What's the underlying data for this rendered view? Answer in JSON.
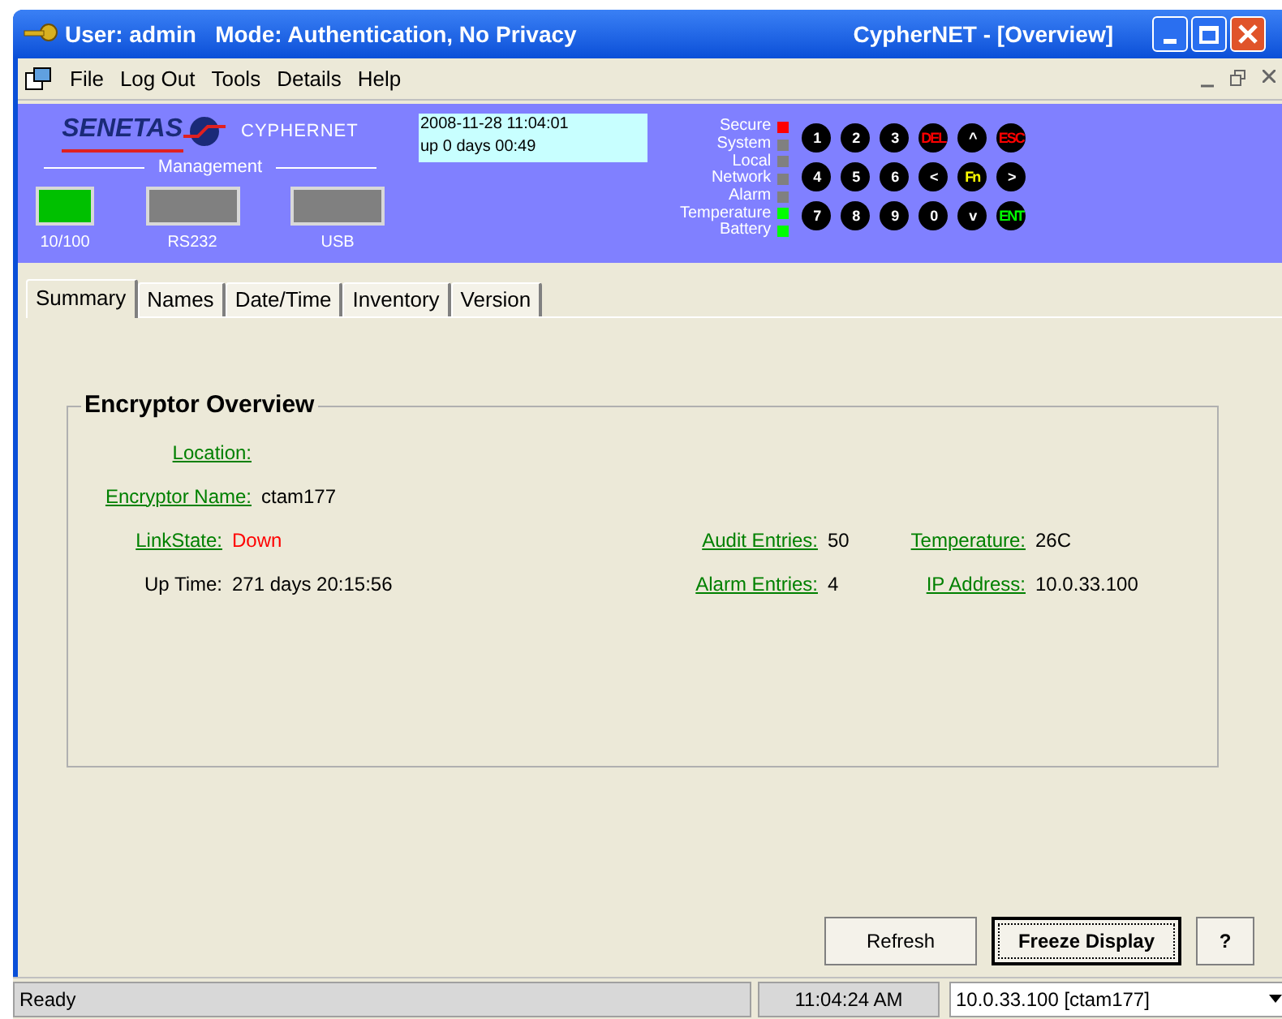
{
  "window": {
    "title_left": "User: admin   Mode: Authentication, No Privacy",
    "title_right": "CypherNET - [Overview]"
  },
  "menu": [
    "File",
    "Log Out",
    "Tools",
    "Details",
    "Help"
  ],
  "device": {
    "brand": "SENETAS",
    "product": "CYPHERNET",
    "clock": "2008-11-28 11:04:01",
    "uptime": "up 0 days 00:49",
    "management_label": "Management",
    "ports": [
      {
        "label": "10/100",
        "on": true
      },
      {
        "label": "RS232",
        "on": false
      },
      {
        "label": "USB",
        "on": false
      }
    ],
    "leds": [
      {
        "label": "Secure",
        "color": "#ff0000"
      },
      {
        "label": "System",
        "color": "#808080"
      },
      {
        "label": "Local",
        "color": "#808080"
      },
      {
        "label": "Network",
        "color": "#808080"
      },
      {
        "label": "Alarm",
        "color": "#808080"
      },
      {
        "label": "Temperature",
        "color": "#00ff00"
      },
      {
        "label": "Battery",
        "color": "#00ff00"
      }
    ],
    "keys": [
      {
        "label": "1",
        "kind": "plain"
      },
      {
        "label": "2",
        "kind": "plain"
      },
      {
        "label": "3",
        "kind": "plain"
      },
      {
        "label": "DEL",
        "kind": "cancel"
      },
      {
        "label": "^",
        "kind": "plain"
      },
      {
        "label": "ESC",
        "kind": "cancel"
      },
      {
        "label": "4",
        "kind": "plain"
      },
      {
        "label": "5",
        "kind": "plain"
      },
      {
        "label": "6",
        "kind": "plain"
      },
      {
        "label": "<",
        "kind": "plain"
      },
      {
        "label": "Fn",
        "kind": "function"
      },
      {
        "label": ">",
        "kind": "plain"
      },
      {
        "label": "7",
        "kind": "plain"
      },
      {
        "label": "8",
        "kind": "plain"
      },
      {
        "label": "9",
        "kind": "plain"
      },
      {
        "label": "0",
        "kind": "plain"
      },
      {
        "label": "v",
        "kind": "plain"
      },
      {
        "label": "ENT",
        "kind": "enter"
      }
    ]
  },
  "tabs": [
    {
      "label": "Summary",
      "selected": true
    },
    {
      "label": "Names",
      "selected": false
    },
    {
      "label": "Date/Time",
      "selected": false
    },
    {
      "label": "Inventory",
      "selected": false
    },
    {
      "label": "Version",
      "selected": false
    }
  ],
  "group": {
    "title": "Encryptor Overview",
    "rows": [
      [
        {
          "label": "Location:",
          "kind": "link"
        }
      ],
      [
        {
          "label": "Encryptor Name:",
          "kind": "link",
          "value": "ctam177",
          "color": "#000000"
        }
      ],
      [
        {
          "label": "LinkState:",
          "kind": "link",
          "value": "Down",
          "color": "#ff0000"
        },
        {
          "label": "Audit Entries:",
          "kind": "link",
          "value": "50",
          "color": "#000000"
        },
        {
          "label": "Temperature:",
          "kind": "link",
          "value": "26C",
          "color": "#000000"
        }
      ],
      [
        {
          "label": "Up Time:",
          "kind": "plain",
          "value": "271 days 20:15:56",
          "color": "#000000"
        },
        {
          "label": "Alarm Entries:",
          "kind": "link",
          "value": "4",
          "color": "#000000"
        },
        {
          "label": "IP Address:",
          "kind": "link",
          "value": "10.0.33.100",
          "color": "#000000"
        }
      ]
    ]
  },
  "buttons": [
    {
      "label": "Refresh",
      "default": false
    },
    {
      "label": "Freeze Display",
      "default": true
    },
    {
      "label": "?",
      "default": false
    }
  ],
  "status_bar": {
    "message": "Ready",
    "time": "11:04:24 AM",
    "device": "10.0.33.100 [ctam177]"
  }
}
